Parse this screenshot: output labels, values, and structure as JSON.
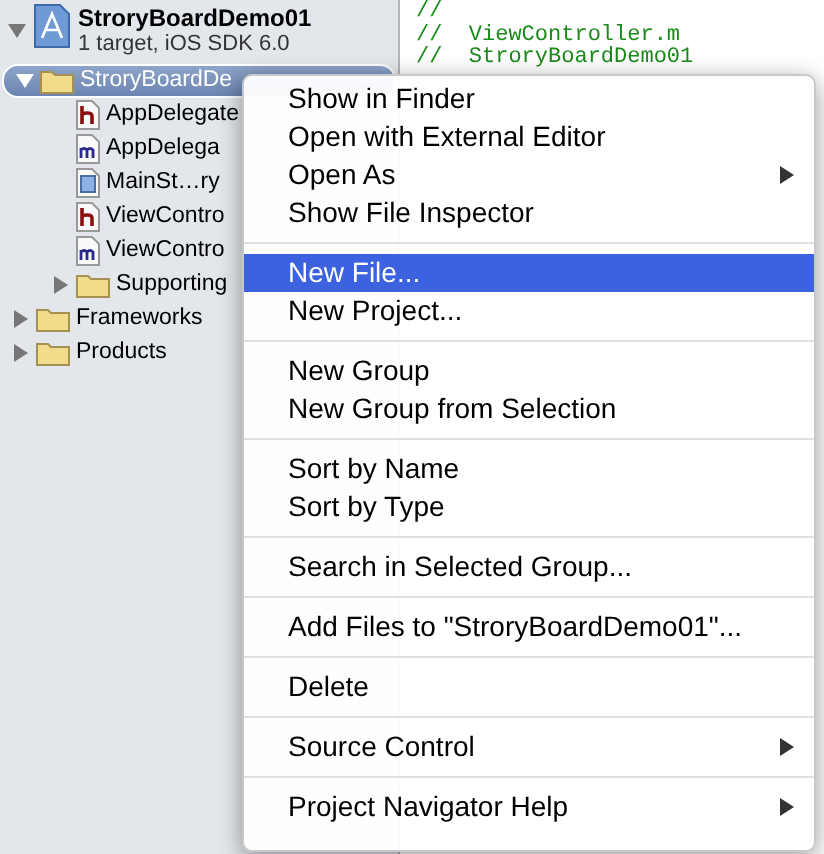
{
  "navigator": {
    "project": {
      "name": "StroryBoardDemo01",
      "subtitle": "1 target, iOS SDK 6.0",
      "expanded": true
    },
    "items": [
      {
        "name": "StroryBoardDe",
        "kind": "folder",
        "expanded": true,
        "selected": true,
        "children": [
          {
            "name": "AppDelegate",
            "kind": "h",
            "selected": false
          },
          {
            "name": "AppDelega",
            "kind": "m",
            "selected": false
          },
          {
            "name": "MainSt…ry",
            "kind": "storyboard",
            "selected": false
          },
          {
            "name": "ViewContro",
            "kind": "h",
            "selected": false
          },
          {
            "name": "ViewContro",
            "kind": "m",
            "selected": false
          },
          {
            "name": "Supporting",
            "kind": "folder",
            "expanded": false,
            "selected": false
          }
        ]
      },
      {
        "name": "Frameworks",
        "kind": "folder",
        "expanded": false,
        "selected": false
      },
      {
        "name": "Products",
        "kind": "folder",
        "expanded": false,
        "selected": false
      }
    ]
  },
  "editor": {
    "lines": [
      "//",
      "//  ViewController.m",
      "//  StroryBoardDemo01"
    ]
  },
  "context_menu": {
    "items": [
      {
        "kind": "item",
        "label": "Show in Finder",
        "submenu": false,
        "selected": false
      },
      {
        "kind": "item",
        "label": "Open with External Editor",
        "submenu": false,
        "selected": false
      },
      {
        "kind": "item",
        "label": "Open As",
        "submenu": true,
        "selected": false
      },
      {
        "kind": "item",
        "label": "Show File Inspector",
        "submenu": false,
        "selected": false
      },
      {
        "kind": "separator"
      },
      {
        "kind": "item",
        "label": "New File...",
        "submenu": false,
        "selected": true
      },
      {
        "kind": "item",
        "label": "New Project...",
        "submenu": false,
        "selected": false
      },
      {
        "kind": "separator"
      },
      {
        "kind": "item",
        "label": "New Group",
        "submenu": false,
        "selected": false
      },
      {
        "kind": "item",
        "label": "New Group from Selection",
        "submenu": false,
        "selected": false
      },
      {
        "kind": "separator"
      },
      {
        "kind": "item",
        "label": "Sort by Name",
        "submenu": false,
        "selected": false
      },
      {
        "kind": "item",
        "label": "Sort by Type",
        "submenu": false,
        "selected": false
      },
      {
        "kind": "separator"
      },
      {
        "kind": "item",
        "label": "Search in Selected Group...",
        "submenu": false,
        "selected": false
      },
      {
        "kind": "separator"
      },
      {
        "kind": "item",
        "label": "Add Files to \"StroryBoardDemo01\"...",
        "submenu": false,
        "selected": false
      },
      {
        "kind": "separator"
      },
      {
        "kind": "item",
        "label": "Delete",
        "submenu": false,
        "selected": false
      },
      {
        "kind": "separator"
      },
      {
        "kind": "item",
        "label": "Source Control",
        "submenu": true,
        "selected": false
      },
      {
        "kind": "separator"
      },
      {
        "kind": "item",
        "label": "Project Navigator Help",
        "submenu": true,
        "selected": false
      }
    ]
  }
}
